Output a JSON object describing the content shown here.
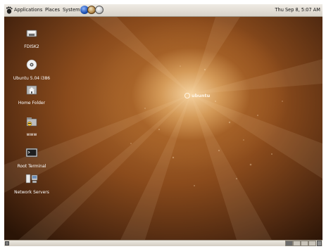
{
  "top_panel": {
    "menus": [
      "Applications",
      "Places",
      "System"
    ],
    "clock": "Thu Sep  8,  5:07 AM"
  },
  "desktop": {
    "brand": "ubuntu",
    "icons": [
      {
        "label": "FDISK2",
        "icon": "floppy-disk-icon"
      },
      {
        "label": "Ubuntu 5.04 i386",
        "icon": "cd-disc-icon"
      },
      {
        "label": "Home Folder",
        "icon": "home-folder-icon"
      },
      {
        "label": "www",
        "icon": "folder-icon"
      },
      {
        "label": "Root Terminal",
        "icon": "terminal-icon"
      },
      {
        "label": "Network Servers",
        "icon": "network-servers-icon"
      }
    ]
  },
  "bottom_panel": {
    "workspaces": 4
  },
  "colors": {
    "panel": "#e4dfd6",
    "desktop_center": "#f6d3a0",
    "desktop_edge": "#2a1406",
    "label_text": "#ffffff"
  }
}
